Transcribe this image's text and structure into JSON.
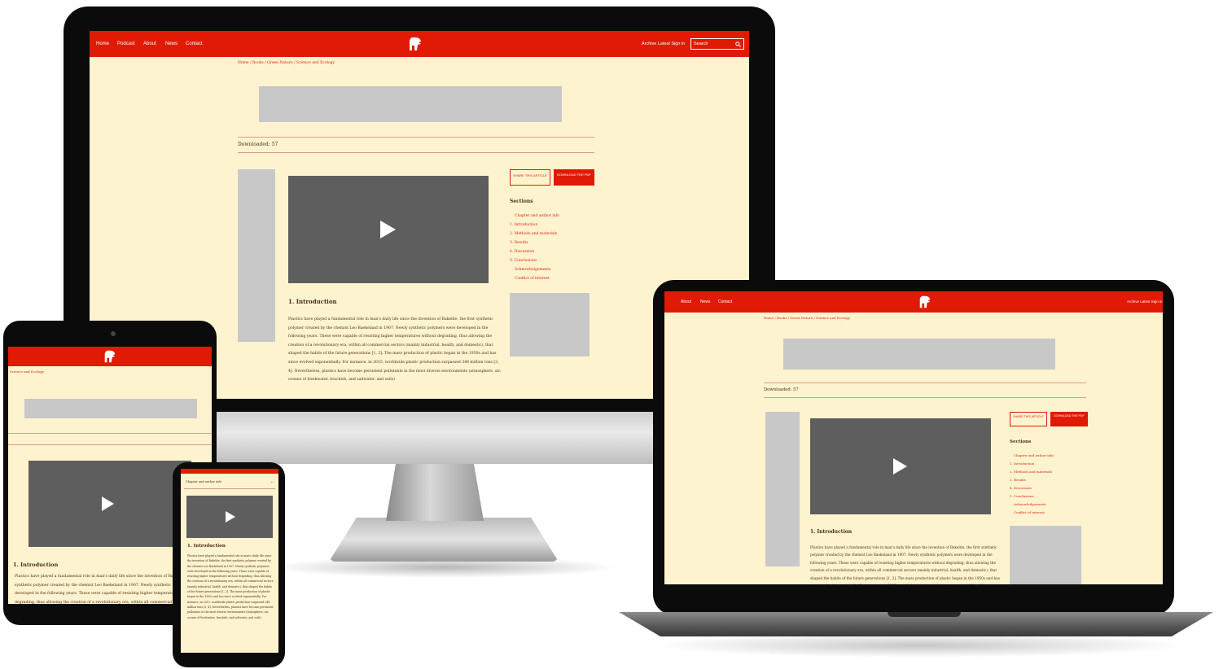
{
  "colors": {
    "brand": "#e11a06",
    "page_background": "#fdf4cf",
    "video": "#5e5e5e",
    "placeholder": "#c8c8c8"
  },
  "nav": {
    "links": [
      "Home",
      "Podcast",
      "About",
      "News",
      "Contact"
    ],
    "right_links": "Archive  Latest  Sign in",
    "search_placeholder": "Search"
  },
  "breadcrumb": "Home / Books / Green Nature / Science and Ecology",
  "breadcrumb_short": "Science and Ecology",
  "downloaded": "Downloaded: 57",
  "buttons": {
    "share": "SHARE THIS ARTICLE",
    "download": "DOWNLOAD THE PDF"
  },
  "sections": {
    "heading": "Sections",
    "items": [
      "Chapter and author info",
      "1. Introduction",
      "2. Methods and materials",
      "3. Results",
      "4. Discussion",
      "5. Conclusions",
      "Acknowledgements",
      "Conflict of interest"
    ]
  },
  "phone_section_label": "Chapter and author info",
  "article": {
    "heading": "1. Introduction",
    "paragraph": "Plastics have played a fundamental role in man's daily life since the invention of Bakelite, the first synthetic polymer created by the chemist Leo Baekeland in 1907. Newly synthetic polymers were developed in the following years. These were capable of resisting higher temperatures without degrading, thus allowing the creation of a revolutionary era, within all commercial sectors (mainly industrial, health, and domestic), that shaped the habits of the future generations [1, 2]. The mass production of plastic began in the 1950s and has since evolved exponentially. For instance, in 2015, worldwide plastic production surpassed 348 million tons [3, 4]. Nevertheless, plastics have become persistent pollutants in the most diverse environments (atmosphere, air, oceans of freshwater, brackish, and saltwater, and soils)"
  },
  "icons": [
    "logo-icon",
    "search-icon",
    "play-icon",
    "share-icon",
    "pdf-icon"
  ]
}
